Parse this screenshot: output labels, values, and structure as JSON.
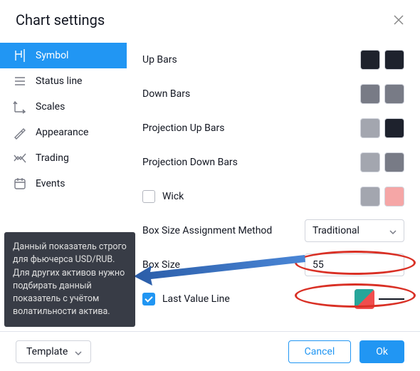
{
  "header": {
    "title": "Chart settings"
  },
  "sidebar": {
    "items": [
      {
        "label": "Symbol"
      },
      {
        "label": "Status line"
      },
      {
        "label": "Scales"
      },
      {
        "label": "Appearance"
      },
      {
        "label": "Trading"
      },
      {
        "label": "Events"
      }
    ]
  },
  "settings": {
    "up_bars": {
      "label": "Up Bars",
      "fill": "#1e222d",
      "border": "#1e222d"
    },
    "down_bars": {
      "label": "Down Bars",
      "fill": "#787b86",
      "border": "#787b86"
    },
    "proj_up": {
      "label": "Projection Up Bars",
      "fill": "#a3a6af",
      "border": "#1e222d"
    },
    "proj_down": {
      "label": "Projection Down Bars",
      "fill": "#a3a6af",
      "border": "#787b86"
    },
    "wick": {
      "label": "Wick",
      "checked": false,
      "fill": "#a3a6af",
      "border": "#f5a6a6"
    },
    "method": {
      "label": "Box Size Assignment Method",
      "value": "Traditional"
    },
    "box_size": {
      "label": "Box Size",
      "value": "55"
    },
    "last_line": {
      "label": "Last Value Line",
      "checked": true
    }
  },
  "tooltip": {
    "text": "Данный показатель строго для фьючерса USD/RUB. Для других активов нужно подбирать данный показатель с учётом волатильности актива."
  },
  "footer": {
    "template": "Template",
    "cancel": "Cancel",
    "ok": "Ok"
  }
}
